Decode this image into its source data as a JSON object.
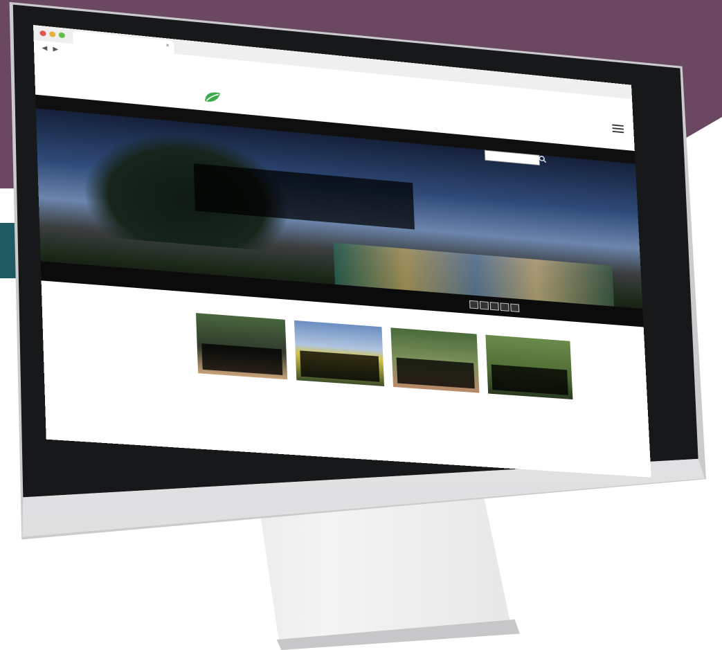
{
  "colors": {
    "backdrop_purple": "#6b4861",
    "backdrop_teal": "#1f5a63",
    "monitor_bezel": "#17181a",
    "monitor_chin": "#e6e6e8",
    "site_nav_bar": "#0f0f0f",
    "logo_green": "#3bab4a"
  },
  "icons": {
    "logo": "green-leaf-logo-icon",
    "menu": "hamburger-menu-icon",
    "search": "search-icon",
    "window_controls": "traffic-light-window-controls"
  },
  "browser": {
    "tab_title": "",
    "url": ""
  },
  "site": {
    "logo_text": "",
    "header_title": "",
    "header_subtitle": "",
    "nav": [
      "",
      "",
      ""
    ],
    "search_placeholder": ""
  },
  "hero": {
    "caption_title": "",
    "caption_line1": "",
    "caption_line2": "",
    "credit": "",
    "slider_label": "",
    "slide_count": 5
  },
  "stories": {
    "section_title": "",
    "cards": [
      {
        "overlay_title": "",
        "overlay_subtitle": "",
        "body": ""
      },
      {
        "overlay_title": "",
        "overlay_subtitle": "",
        "body": ""
      },
      {
        "overlay_title": "",
        "overlay_subtitle": "",
        "body": ""
      },
      {
        "overlay_title": "",
        "overlay_subtitle": "",
        "body": ""
      }
    ]
  }
}
